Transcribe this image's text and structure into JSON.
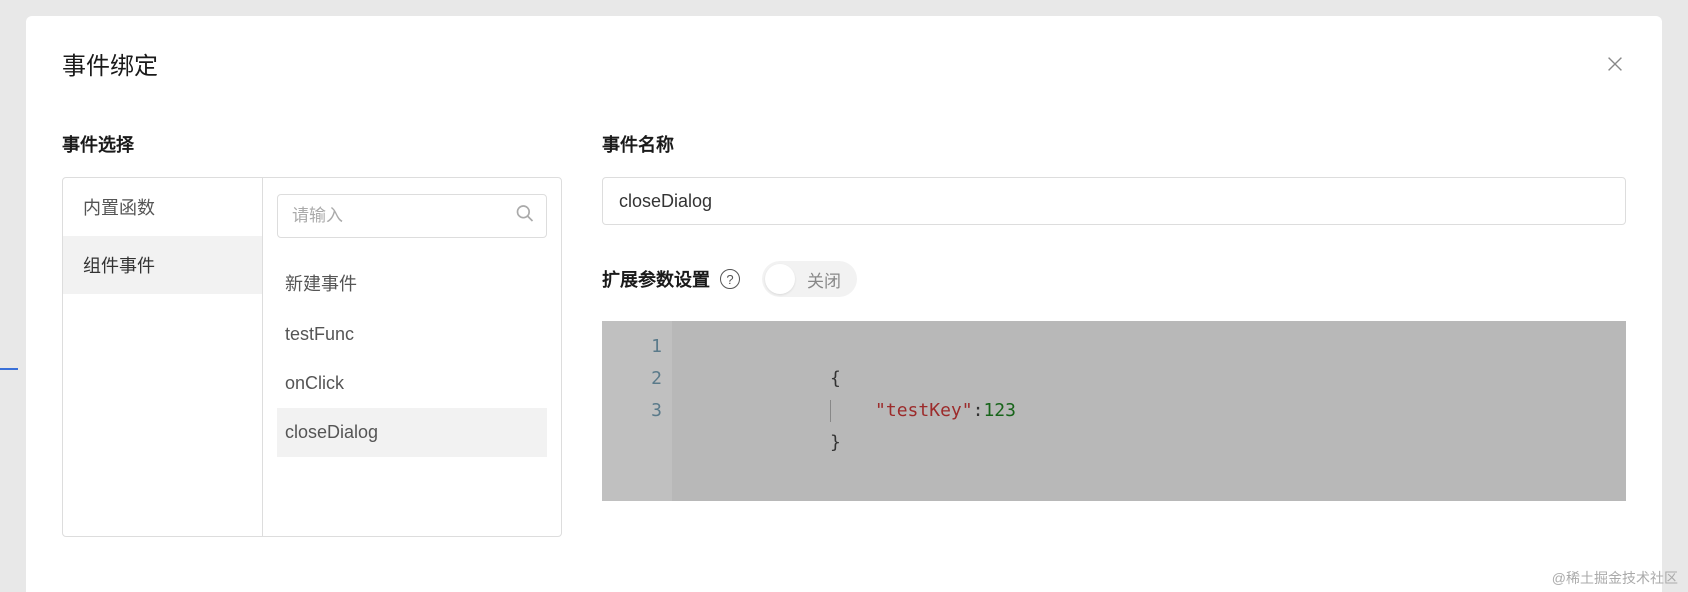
{
  "dialog": {
    "title": "事件绑定"
  },
  "leftPanel": {
    "label": "事件选择",
    "tabs": [
      "内置函数",
      "组件事件"
    ],
    "activeTab": 1,
    "search": {
      "placeholder": "请输入"
    },
    "events": [
      "新建事件",
      "testFunc",
      "onClick",
      "closeDialog"
    ],
    "selectedEvent": 3
  },
  "rightPanel": {
    "nameLabel": "事件名称",
    "nameValue": "closeDialog",
    "paramsLabel": "扩展参数设置",
    "helpGlyph": "?",
    "toggleState": "关闭",
    "code": {
      "lineNumbers": [
        "1",
        "2",
        "3"
      ],
      "line1": "{",
      "line2_key": "\"testKey\"",
      "line2_colon": ":",
      "line2_val": "123",
      "line3": "}"
    }
  },
  "watermark": "@稀土掘金技术社区"
}
